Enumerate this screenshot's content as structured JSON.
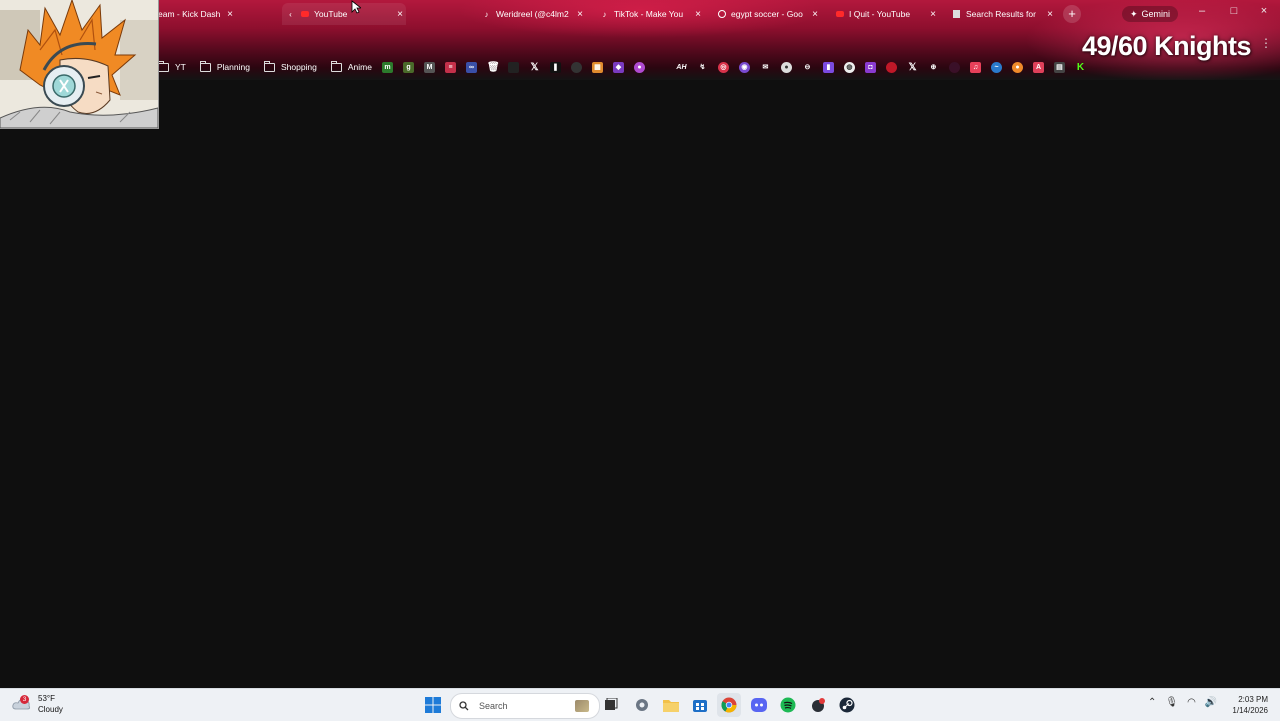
{
  "browser": {
    "tabs": [
      {
        "title": "eam - Kick Dash",
        "icon": "kick-icon",
        "active": false
      },
      {
        "title": "YouTube",
        "icon": "youtube-icon",
        "active": true
      },
      {
        "title": "Weridreel (@c4lm2",
        "icon": "tiktok-icon",
        "active": false
      },
      {
        "title": "TikTok - Make You",
        "icon": "tiktok-icon",
        "active": false
      },
      {
        "title": "egypt soccer - Goo",
        "icon": "google-icon",
        "active": false
      },
      {
        "title": "I Quit - YouTube",
        "icon": "youtube-icon",
        "active": false
      },
      {
        "title": "Search Results for",
        "icon": "search-results-icon",
        "active": false
      }
    ],
    "new_tab_label": "+",
    "gemini_label": "Gemini",
    "bookmarks": {
      "folders": [
        "YT",
        "Planning",
        "Shopping",
        "Anime"
      ]
    }
  },
  "overlay": {
    "counter_text": "49/60 Knights"
  },
  "taskbar": {
    "weather_temp": "53°F",
    "weather_desc": "Cloudy",
    "weather_badge": "3",
    "search_placeholder": "Search",
    "time": "2:03 PM",
    "date": "1/14/2026"
  },
  "colors": {
    "theme_red": "#8e0f2e",
    "page_bg": "#0f0f0f",
    "taskbar_bg": "#eef1f5"
  }
}
